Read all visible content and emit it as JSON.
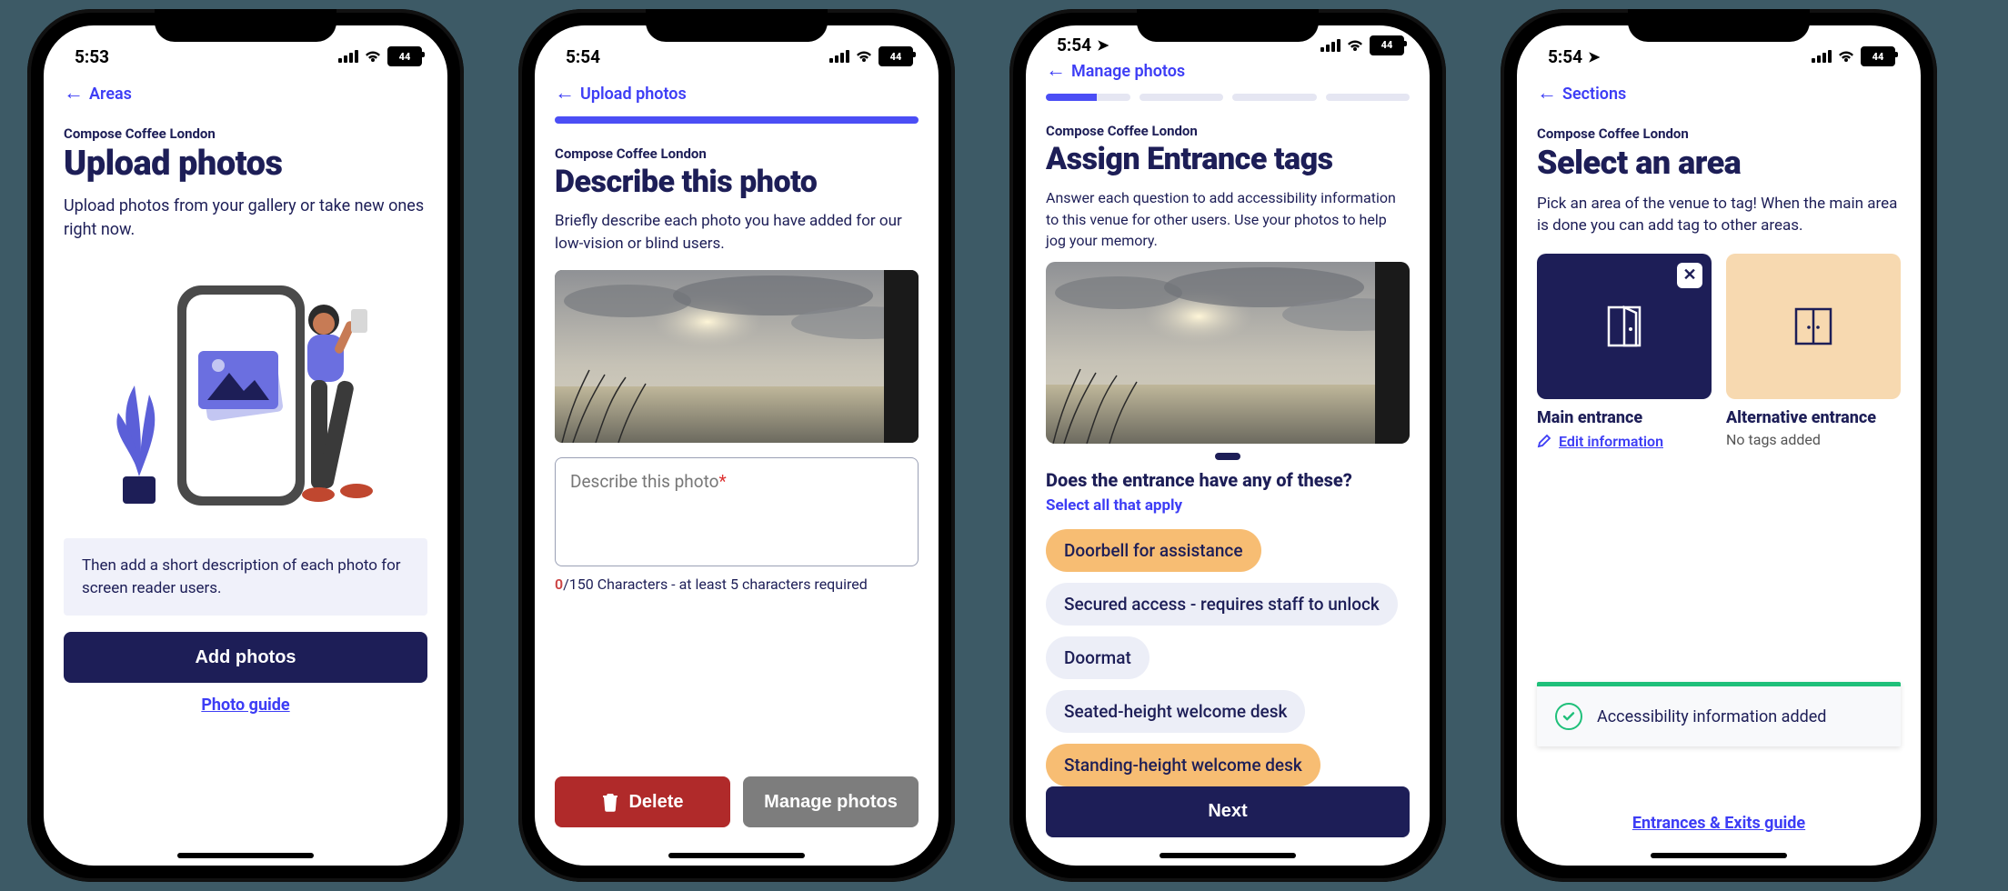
{
  "status": {
    "battery": "44"
  },
  "phones": [
    {
      "time": "5:53",
      "back": "Areas",
      "venue": "Compose Coffee London",
      "title": "Upload photos",
      "lead": "Upload photos from your gallery or take new ones right now.",
      "info": "Then add a short description of each photo for screen reader users.",
      "primary": "Add photos",
      "link": "Photo guide"
    },
    {
      "time": "5:54",
      "back": "Upload photos",
      "venue": "Compose Coffee London",
      "title": "Describe this photo",
      "lead": "Briefly describe each photo you have added for our low-vision or blind users.",
      "placeholder": "Describe this photo",
      "counter_zero": "0",
      "counter_rest": "/150 Characters - at least 5 characters required",
      "delete": "Delete",
      "manage": "Manage photos"
    },
    {
      "time": "5:54",
      "back": "Manage photos",
      "venue": "Compose Coffee London",
      "title": "Assign Entrance tags",
      "lead": "Answer each question to add accessibility information to this venue for other users. Use your photos to help jog your memory.",
      "question": "Does the entrance have any of these?",
      "hint": "Select all that apply",
      "tags": [
        {
          "label": "Doorbell for assistance",
          "on": true
        },
        {
          "label": "Secured access - requires staff to unlock",
          "on": false
        },
        {
          "label": "Doormat",
          "on": false
        },
        {
          "label": "Seated-height welcome desk",
          "on": false
        },
        {
          "label": "Standing-height welcome desk",
          "on": true
        }
      ],
      "primary": "Next"
    },
    {
      "time": "5:54",
      "back": "Sections",
      "venue": "Compose Coffee London",
      "title": "Select an area",
      "lead": "Pick an area of the venue to tag! When the main area is done you can add tag to other areas.",
      "cards": [
        {
          "title": "Main entrance",
          "sub": "Edit information",
          "close": true,
          "dark": true
        },
        {
          "title": "Alternative entrance",
          "sub": "No tags added",
          "close": false,
          "dark": false
        }
      ],
      "toast": "Accessibility information added",
      "link": "Entrances & Exits guide"
    }
  ]
}
